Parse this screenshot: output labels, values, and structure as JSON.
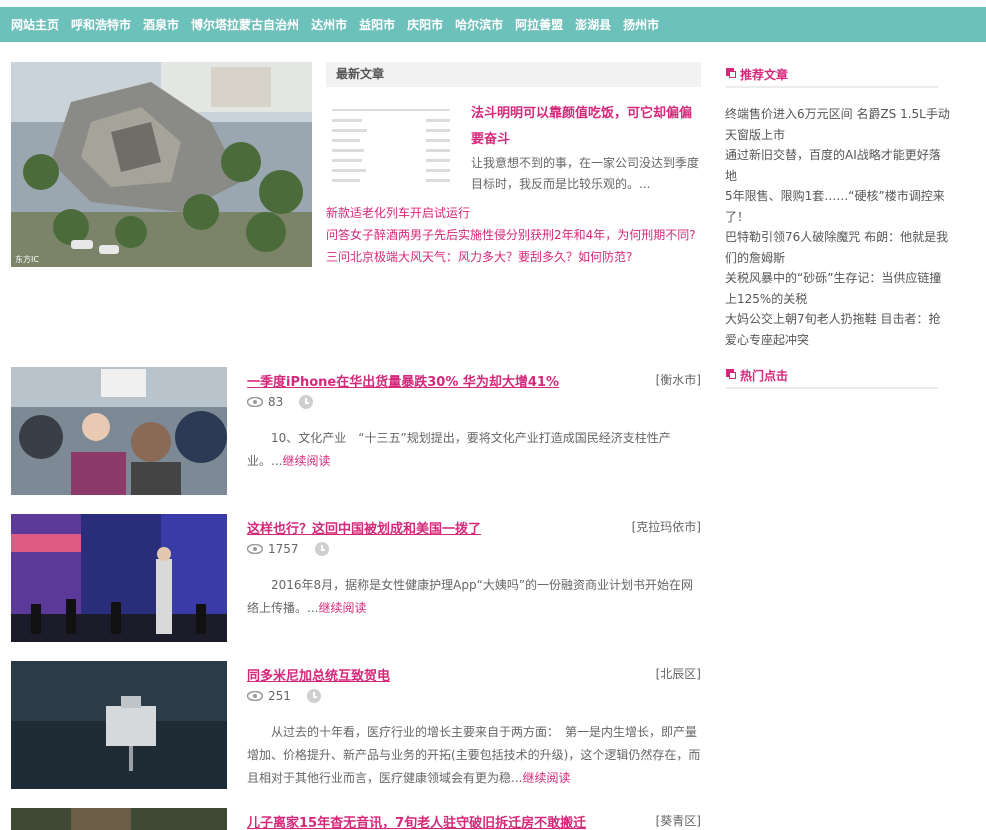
{
  "nav": {
    "items": [
      "网站主页",
      "呼和浩特市",
      "酒泉市",
      "博尔塔拉蒙古自治州",
      "达州市",
      "益阳市",
      "庆阳市",
      "哈尔滨市",
      "阿拉善盟",
      "澎湖县",
      "扬州市"
    ]
  },
  "feature": {
    "hero_image_credit": "东方IC",
    "latest_heading": "最新文章",
    "latest_title": "法斗明明可以靠颜值吃饭，可它却偏偏要奋斗",
    "latest_desc": "让我意想不到的事，在一家公司没达到季度目标时，我反而是比较乐观的。...",
    "links": [
      "新款适老化列车开启试运行",
      "问答女子醉酒两男子先后实施性侵分别获刑2年和4年，为何刑期不同?",
      "三问北京极端大风天气：风力多大？要刮多久？如何防范?"
    ]
  },
  "articles": [
    {
      "title": "一季度iPhone在华出货量暴跌30% 华为却大增41%",
      "region": "[衡水市]",
      "views": "83",
      "summary": "10、文化产业　“十三五”规划提出，要将文化产业打造成国民经济支柱性产业。...",
      "more": "继续阅读"
    },
    {
      "title": "这样也行？这回中国被划成和美国一拨了",
      "region": "[克拉玛依市]",
      "views": "1757",
      "summary": "2016年8月，据称是女性健康护理App“大姨吗”的一份融资商业计划书开始在网络上传播。...",
      "more": "继续阅读"
    },
    {
      "title": "同多米尼加总统互致贺电",
      "region": "[北辰区]",
      "views": "251",
      "summary": "从过去的十年看，医疗行业的增长主要来自于两方面：　第一是内生增长，即产量增加、价格提升、新产品与业务的开拓(主要包括技术的升级)，这个逻辑仍然存在，而且相对于其他行业而言，医疗健康领域会有更为稳...",
      "more": "继续阅读"
    },
    {
      "title": "儿子离家15年杳无音讯，7旬老人驻守破旧拆迁房不敢搬迁",
      "region": "[葵青区]",
      "views": "",
      "summary": "",
      "more": ""
    }
  ],
  "sidebar": {
    "recommended_heading": "推荐文章",
    "recommended": [
      "终端售价进入6万元区间 名爵ZS 1.5L手动天窗版上市",
      "通过新旧交替，百度的AI战略才能更好落地",
      "5年限售、限购1套……“硬核”楼市调控来了！",
      "巴特勒引领76人破除魔咒 布朗：他就是我们的詹姆斯",
      "关税风暴中的“砂砾”生存记：当供应链撞上125%的关税",
      "大妈公交上朝7旬老人扔拖鞋 目击者：抢爱心专座起冲突"
    ],
    "hot_heading": "热门点击"
  },
  "colors": {
    "nav_bg": "#6cc2ba",
    "accent": "#d6287a"
  }
}
